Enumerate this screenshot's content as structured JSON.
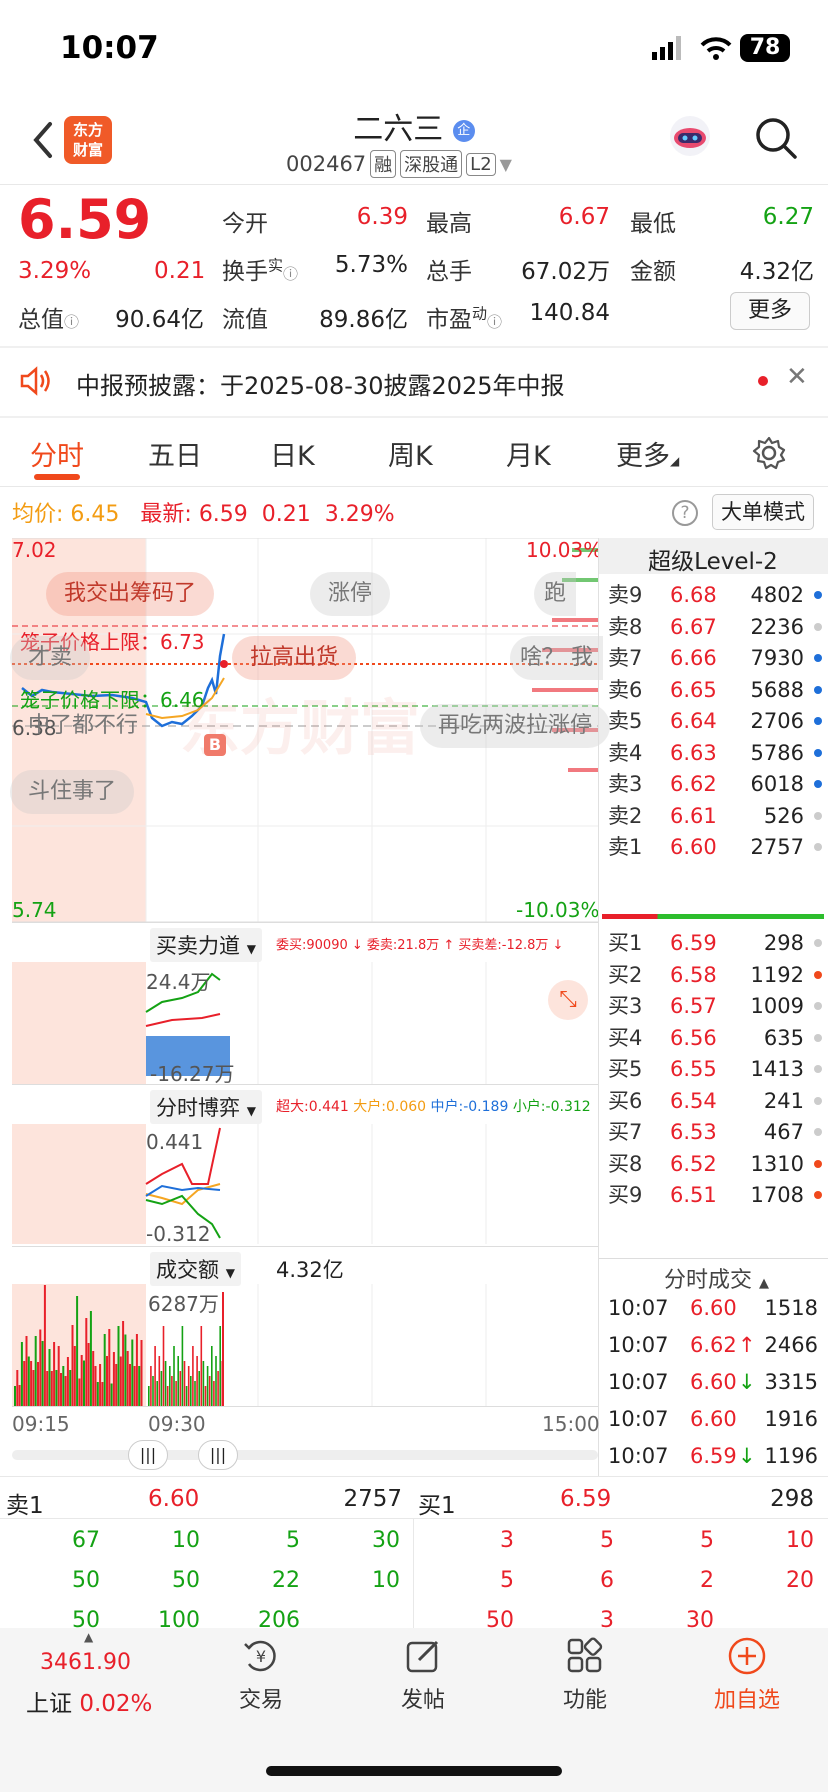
{
  "status_bar": {
    "time": "10:07",
    "battery": "78"
  },
  "header": {
    "title": "二六三",
    "title_badge": "企",
    "code": "002467",
    "tags": [
      "融",
      "深股通",
      "L2"
    ],
    "logo_line1": "东方",
    "logo_line2": "财富"
  },
  "quote": {
    "price": "6.59",
    "pct": "3.29%",
    "change": "0.21",
    "open_label": "今开",
    "open": "6.39",
    "high_label": "最高",
    "high": "6.67",
    "low_label": "最低",
    "low": "6.27",
    "turnover_label": "换手",
    "turnover_sup": "实",
    "turnover": "5.73%",
    "volume_label": "总手",
    "volume": "67.02万",
    "amount_label": "金额",
    "amount": "4.32亿",
    "mktcap_label": "总值",
    "mktcap": "90.64亿",
    "float_label": "流值",
    "float": "89.86亿",
    "pe_label": "市盈",
    "pe_sup": "动",
    "pe": "140.84",
    "more": "更多"
  },
  "notice": {
    "text": "中报预披露：于2025-08-30披露2025年中报"
  },
  "tabs": [
    "分时",
    "五日",
    "日K",
    "周K",
    "月K",
    "更多"
  ],
  "chart": {
    "avg_label": "均价:",
    "avg": "6.45",
    "latest_label": "最新:",
    "latest": "6.59",
    "latest_chg": "0.21",
    "latest_pct": "3.29%",
    "big_order_mode": "大单模式",
    "y_top": "7.02",
    "y_bottom": "5.74",
    "pct_top": "10.03%",
    "pct_bottom": "-10.03%",
    "y_mid": "6.38",
    "cage_upper": "笼子价格上限：6.73",
    "cage_lower": "笼子价格下限：6.46",
    "bubbles": [
      "我交出筹码了",
      "涨停",
      "跑",
      "才卖",
      "拉高出货",
      "啥？ 我",
      "中了都不行",
      "再吃两波拉涨停",
      "斗住事了"
    ],
    "watermark": "东方财富",
    "trade_marker": "B"
  },
  "panel_force": {
    "title": "买卖力道",
    "wb": "委买:90090 ↓",
    "ws": "委卖:21.8万 ↑",
    "diff": "买卖差:-12.8万 ↓",
    "top": "24.4万",
    "bottom": "-16.27万"
  },
  "panel_game": {
    "title": "分时博弈",
    "xl": "超大:0.441",
    "l": "大户:0.060",
    "m": "中户:-0.189",
    "s": "小户:-0.312",
    "top": "0.441",
    "bottom": "-0.312"
  },
  "panel_amount": {
    "title": "成交额",
    "value": "4.32亿",
    "peak": "6287万"
  },
  "time_axis": {
    "start": "09:15",
    "open": "09:30",
    "end": "15:00"
  },
  "level2": {
    "title": "超级Level-2",
    "asks": [
      {
        "label": "卖9",
        "price": "6.68",
        "vol": "4802",
        "dot": "#1e6fd9"
      },
      {
        "label": "卖8",
        "price": "6.67",
        "vol": "2236",
        "dot": "#cccccc"
      },
      {
        "label": "卖7",
        "price": "6.66",
        "vol": "7930",
        "dot": "#1e6fd9"
      },
      {
        "label": "卖6",
        "price": "6.65",
        "vol": "5688",
        "dot": "#1e6fd9"
      },
      {
        "label": "卖5",
        "price": "6.64",
        "vol": "2706",
        "dot": "#1e6fd9"
      },
      {
        "label": "卖4",
        "price": "6.63",
        "vol": "5786",
        "dot": "#1e6fd9"
      },
      {
        "label": "卖3",
        "price": "6.62",
        "vol": "6018",
        "dot": "#1e6fd9"
      },
      {
        "label": "卖2",
        "price": "6.61",
        "vol": "526",
        "dot": "#cccccc"
      },
      {
        "label": "卖1",
        "price": "6.60",
        "vol": "2757",
        "dot": "#cccccc"
      }
    ],
    "bids": [
      {
        "label": "买1",
        "price": "6.59",
        "vol": "298",
        "dot": "#cccccc"
      },
      {
        "label": "买2",
        "price": "6.58",
        "vol": "1192",
        "dot": "#f0491c"
      },
      {
        "label": "买3",
        "price": "6.57",
        "vol": "1009",
        "dot": "#cccccc"
      },
      {
        "label": "买4",
        "price": "6.56",
        "vol": "635",
        "dot": "#cccccc"
      },
      {
        "label": "买5",
        "price": "6.55",
        "vol": "1413",
        "dot": "#cccccc"
      },
      {
        "label": "买6",
        "price": "6.54",
        "vol": "241",
        "dot": "#cccccc"
      },
      {
        "label": "买7",
        "price": "6.53",
        "vol": "467",
        "dot": "#cccccc"
      },
      {
        "label": "买8",
        "price": "6.52",
        "vol": "1310",
        "dot": "#f0491c"
      },
      {
        "label": "买9",
        "price": "6.51",
        "vol": "1708",
        "dot": "#f0491c"
      }
    ],
    "ticks_title": "分时成交",
    "ticks": [
      {
        "t": "10:07",
        "p": "6.60",
        "a": "",
        "v": "1518",
        "c": "#14a214"
      },
      {
        "t": "10:07",
        "p": "6.62",
        "a": "↑",
        "v": "2466",
        "c": "#e8202a"
      },
      {
        "t": "10:07",
        "p": "6.60",
        "a": "↓",
        "v": "3315",
        "c": "#14a214"
      },
      {
        "t": "10:07",
        "p": "6.60",
        "a": "",
        "v": "1916",
        "c": "#e8202a"
      },
      {
        "t": "10:07",
        "p": "6.59",
        "a": "↓",
        "v": "1196",
        "c": "#14a214"
      }
    ]
  },
  "queue": {
    "ask_label": "卖1",
    "ask_price": "6.60",
    "ask_vol": "2757",
    "bid_label": "买1",
    "bid_price": "6.59",
    "bid_vol": "298",
    "ask_rows": [
      [
        "67",
        "10",
        "5",
        "30"
      ],
      [
        "50",
        "50",
        "22",
        "10"
      ],
      [
        "50",
        "100",
        "206",
        ""
      ]
    ],
    "bid_rows": [
      [
        "3",
        "5",
        "5",
        "10"
      ],
      [
        "5",
        "6",
        "2",
        "20"
      ],
      [
        "50",
        "3",
        "30",
        ""
      ]
    ]
  },
  "bottom_nav": {
    "index_value": "3461.90",
    "index_name": "上证",
    "index_pct": "0.02%",
    "trade": "交易",
    "post": "发帖",
    "func": "功能",
    "add": "加自选"
  }
}
